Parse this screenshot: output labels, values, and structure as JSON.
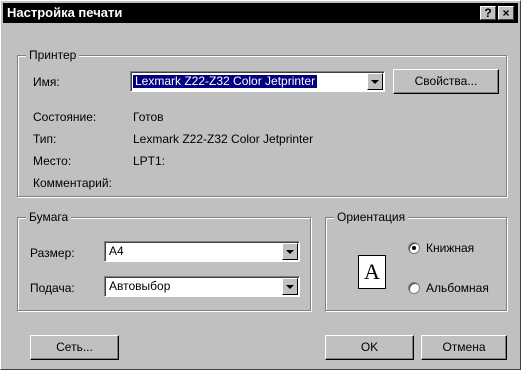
{
  "window": {
    "title": "Настройка печати",
    "help_button": "?",
    "close_button": "×"
  },
  "printer": {
    "group_label": "Принтер",
    "name_label": "Имя:",
    "name_value": "Lexmark Z22-Z32 Color Jetprinter",
    "properties_button": "Свойства...",
    "status_label": "Состояние:",
    "status_value": "Готов",
    "type_label": "Тип:",
    "type_value": "Lexmark Z22-Z32 Color Jetprinter",
    "location_label": "Место:",
    "location_value": "LPT1:",
    "comment_label": "Комментарий:",
    "comment_value": ""
  },
  "paper": {
    "group_label": "Бумага",
    "size_label": "Размер:",
    "size_value": "A4",
    "source_label": "Подача:",
    "source_value": "Автовыбор"
  },
  "orientation": {
    "group_label": "Ориентация",
    "icon_letter": "A",
    "portrait_label": "Книжная",
    "landscape_label": "Альбомная",
    "selected": "portrait"
  },
  "buttons": {
    "network": "Сеть...",
    "ok": "OK",
    "cancel": "Отмена"
  }
}
